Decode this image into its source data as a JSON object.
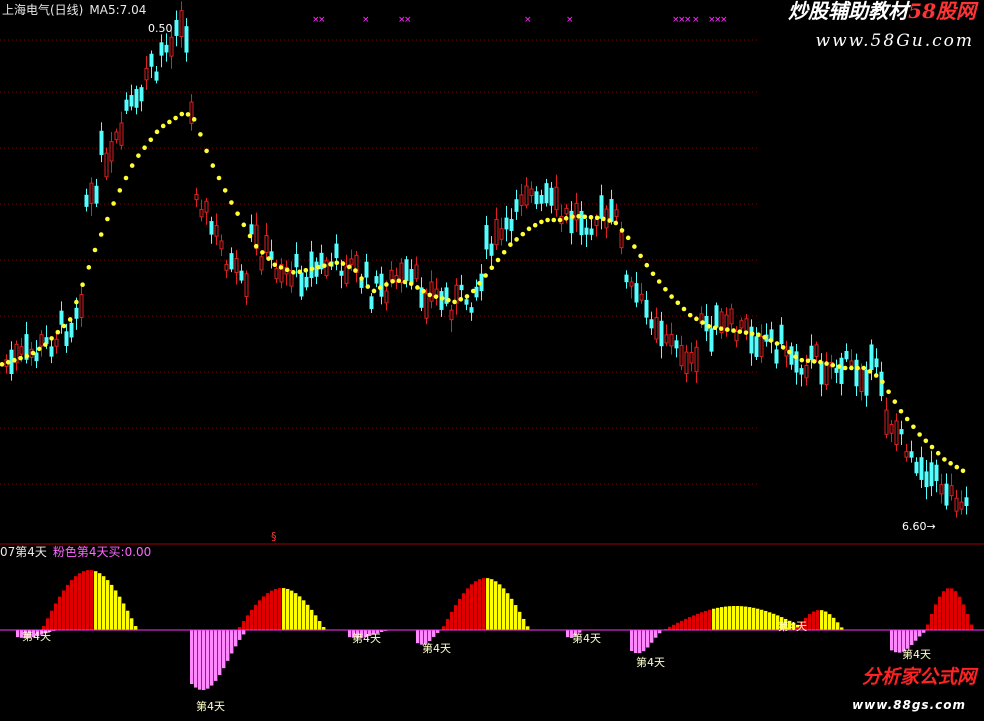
{
  "header": {
    "stock_name": "上海电气(日线)",
    "ma_label": "MA5:7.04"
  },
  "annotations": {
    "high_price": "0.50",
    "low_price": "6.60→",
    "signal_mark": "§"
  },
  "indicator": {
    "name": "07第4天",
    "line_label": "粉色第4天买:0.00",
    "bar_tag": "第4天"
  },
  "watermarks": {
    "top_cn_prefix": "炒股辅助教材",
    "top_cn_brand": "58股网",
    "top_url": "www.58Gu.com",
    "bottom_cn": "分析家公式网",
    "bottom_url": "www.88gs.com"
  },
  "colors": {
    "up_candle": "#e02020",
    "down_candle": "#54ffff",
    "ma_dots": "#ffff33",
    "grid": "#800000",
    "separator": "#a00000",
    "zero_line": "#ff33ff",
    "pink_bar": "#ff88ff",
    "red_hist": "#e00000",
    "yellow_hist": "#ffff00",
    "markers": "#ff33ff"
  },
  "chart_data": [
    {
      "type": "candlestick",
      "title": "上海电气(日线)",
      "series": [
        {
          "name": "MA5",
          "values": [
            7.04
          ]
        }
      ],
      "annotations": [
        "0.50",
        "6.60"
      ]
    },
    {
      "type": "bar",
      "title": "07第4天",
      "series": [
        {
          "name": "粉色第4天买",
          "values": [
            0.0
          ]
        }
      ]
    }
  ]
}
